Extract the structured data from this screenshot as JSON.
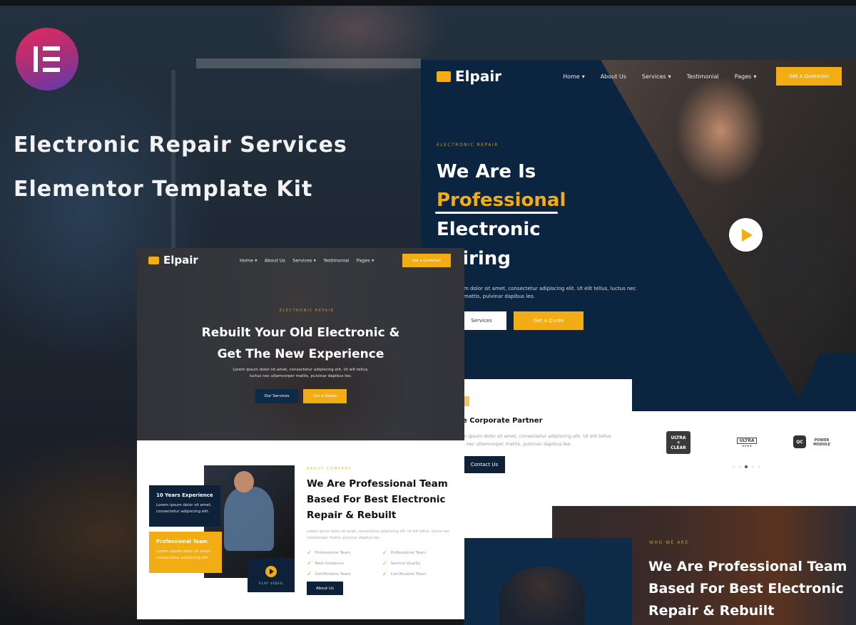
{
  "kit": {
    "title_line1": "Electronic Repair Services",
    "title_line2": "Elementor Template Kit",
    "logo_icon": "elementor-logo-icon"
  },
  "brand": {
    "name": "Elpair",
    "icon": "toolbox-icon",
    "accent_color": "#f3ad14",
    "navy_color": "#0b2440"
  },
  "nav": {
    "items": [
      {
        "label": "Home",
        "has_dropdown": true
      },
      {
        "label": "About Us",
        "has_dropdown": false
      },
      {
        "label": "Services",
        "has_dropdown": true
      },
      {
        "label": "Testimonial",
        "has_dropdown": false
      },
      {
        "label": "Pages",
        "has_dropdown": true
      }
    ],
    "cta_label": "Get a Quotation",
    "dropdown_glyph": "⌄"
  },
  "hero_right": {
    "eyebrow": "ELECTRONIC REPAIR",
    "heading_line1": "We Are Is",
    "heading_highlight": "Professional",
    "heading_line3": "Electronic",
    "heading_line4": "Repairing",
    "heading_line4_visible": "pairing",
    "body_line1": "m dolor sit amet, consectetur adipiscing elit. Ut elit tellus, luctus nec",
    "body_line2": "mattis, pulvinar dapibus leo.",
    "btn_services": "Services",
    "btn_quote": "Get a Quote"
  },
  "partner": {
    "heading": "Corporate Partner",
    "heading_visible": "e Corporate Partner",
    "body_line1": "m ipsum dolor sit amet, consectetur adipiscing elit. Ut elit tellus",
    "body_line2": "c nec ullamcorper mattis, pulvinar dapibus leo.",
    "btn_contact": "Contact Us",
    "logos": [
      {
        "name": "ultra-clear-logo",
        "text_top": "ULTRA",
        "text_bottom": "CLEAR"
      },
      {
        "name": "ultra-laurel-logo",
        "text_top": "ULTRA",
        "text_bottom": "★★★★"
      },
      {
        "name": "qc-power-module-logo",
        "text_top": "QC",
        "text_bottom": "POWER MODULE"
      }
    ],
    "carousel_dots": 5,
    "carousel_active": 2
  },
  "hero_left": {
    "eyebrow": "ELECTRONIC REPAIR",
    "heading_line1": "Rebuilt Your Old Electronic &",
    "heading_line2": "Get The New Experience",
    "body_line1": "Lorem ipsum dolor sit amet, consectetur adipiscing elit. Ut elit tellus,",
    "body_line2": "luctus nec ullamcorper mattis, pulvinar dapibus leo.",
    "btn_services": "Our Services",
    "btn_quote": "Get a Quote"
  },
  "about_left": {
    "eyebrow": "ABOUT COMPANY",
    "heading_line1": "We Are Professional Team",
    "heading_line2": "Based For Best Electronic",
    "heading_line3": "Repair & Rebuilt",
    "body_line1": "Lorem ipsum dolor sit amet, consectetur adipiscing elit. Ut elit tellus, luctus nec",
    "body_line2": "ullamcorper mattis, pulvinar dapibus leo.",
    "cards": [
      {
        "title": "10 Years Experience",
        "text": "Lorem ipsum dolor sit amet, consectetur adipiscing elit."
      },
      {
        "title": "Professional Team",
        "text": "Lorem ipsum dolor sit amet, consectetur adipiscing elit."
      }
    ],
    "play_label": "PLAY VIDEO",
    "checklist_left": [
      "Professional Team",
      "Best Guidance",
      "Certification Team"
    ],
    "checklist_right": [
      "Professional Team",
      "Service Quality",
      "Certification Team"
    ],
    "btn_about": "About Us"
  },
  "about_right": {
    "eyebrow": "WHO WE ARE",
    "heading_line1": "We Are Professional Team",
    "heading_line2": "Based For Best Electronic",
    "heading_line3": "Repair & Rebuilt"
  }
}
